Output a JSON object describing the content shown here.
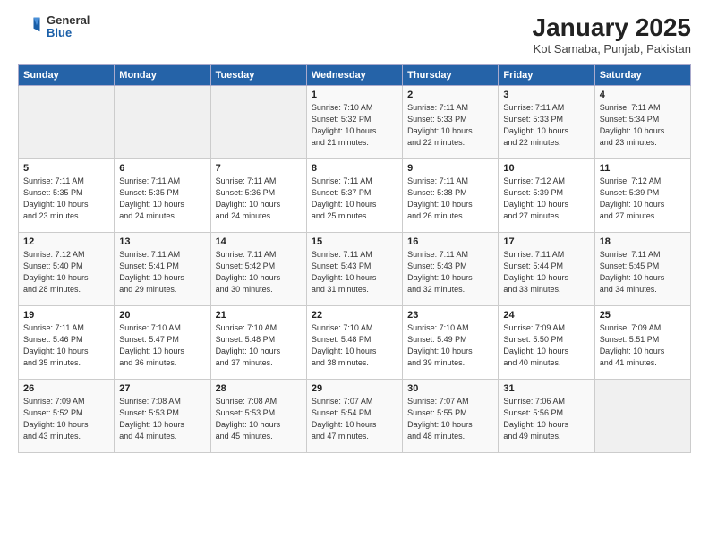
{
  "header": {
    "logo_general": "General",
    "logo_blue": "Blue",
    "title": "January 2025",
    "subtitle": "Kot Samaba, Punjab, Pakistan"
  },
  "days_of_week": [
    "Sunday",
    "Monday",
    "Tuesday",
    "Wednesday",
    "Thursday",
    "Friday",
    "Saturday"
  ],
  "weeks": [
    [
      {
        "num": "",
        "info": ""
      },
      {
        "num": "",
        "info": ""
      },
      {
        "num": "",
        "info": ""
      },
      {
        "num": "1",
        "info": "Sunrise: 7:10 AM\nSunset: 5:32 PM\nDaylight: 10 hours\nand 21 minutes."
      },
      {
        "num": "2",
        "info": "Sunrise: 7:11 AM\nSunset: 5:33 PM\nDaylight: 10 hours\nand 22 minutes."
      },
      {
        "num": "3",
        "info": "Sunrise: 7:11 AM\nSunset: 5:33 PM\nDaylight: 10 hours\nand 22 minutes."
      },
      {
        "num": "4",
        "info": "Sunrise: 7:11 AM\nSunset: 5:34 PM\nDaylight: 10 hours\nand 23 minutes."
      }
    ],
    [
      {
        "num": "5",
        "info": "Sunrise: 7:11 AM\nSunset: 5:35 PM\nDaylight: 10 hours\nand 23 minutes."
      },
      {
        "num": "6",
        "info": "Sunrise: 7:11 AM\nSunset: 5:35 PM\nDaylight: 10 hours\nand 24 minutes."
      },
      {
        "num": "7",
        "info": "Sunrise: 7:11 AM\nSunset: 5:36 PM\nDaylight: 10 hours\nand 24 minutes."
      },
      {
        "num": "8",
        "info": "Sunrise: 7:11 AM\nSunset: 5:37 PM\nDaylight: 10 hours\nand 25 minutes."
      },
      {
        "num": "9",
        "info": "Sunrise: 7:11 AM\nSunset: 5:38 PM\nDaylight: 10 hours\nand 26 minutes."
      },
      {
        "num": "10",
        "info": "Sunrise: 7:12 AM\nSunset: 5:39 PM\nDaylight: 10 hours\nand 27 minutes."
      },
      {
        "num": "11",
        "info": "Sunrise: 7:12 AM\nSunset: 5:39 PM\nDaylight: 10 hours\nand 27 minutes."
      }
    ],
    [
      {
        "num": "12",
        "info": "Sunrise: 7:12 AM\nSunset: 5:40 PM\nDaylight: 10 hours\nand 28 minutes."
      },
      {
        "num": "13",
        "info": "Sunrise: 7:11 AM\nSunset: 5:41 PM\nDaylight: 10 hours\nand 29 minutes."
      },
      {
        "num": "14",
        "info": "Sunrise: 7:11 AM\nSunset: 5:42 PM\nDaylight: 10 hours\nand 30 minutes."
      },
      {
        "num": "15",
        "info": "Sunrise: 7:11 AM\nSunset: 5:43 PM\nDaylight: 10 hours\nand 31 minutes."
      },
      {
        "num": "16",
        "info": "Sunrise: 7:11 AM\nSunset: 5:43 PM\nDaylight: 10 hours\nand 32 minutes."
      },
      {
        "num": "17",
        "info": "Sunrise: 7:11 AM\nSunset: 5:44 PM\nDaylight: 10 hours\nand 33 minutes."
      },
      {
        "num": "18",
        "info": "Sunrise: 7:11 AM\nSunset: 5:45 PM\nDaylight: 10 hours\nand 34 minutes."
      }
    ],
    [
      {
        "num": "19",
        "info": "Sunrise: 7:11 AM\nSunset: 5:46 PM\nDaylight: 10 hours\nand 35 minutes."
      },
      {
        "num": "20",
        "info": "Sunrise: 7:10 AM\nSunset: 5:47 PM\nDaylight: 10 hours\nand 36 minutes."
      },
      {
        "num": "21",
        "info": "Sunrise: 7:10 AM\nSunset: 5:48 PM\nDaylight: 10 hours\nand 37 minutes."
      },
      {
        "num": "22",
        "info": "Sunrise: 7:10 AM\nSunset: 5:48 PM\nDaylight: 10 hours\nand 38 minutes."
      },
      {
        "num": "23",
        "info": "Sunrise: 7:10 AM\nSunset: 5:49 PM\nDaylight: 10 hours\nand 39 minutes."
      },
      {
        "num": "24",
        "info": "Sunrise: 7:09 AM\nSunset: 5:50 PM\nDaylight: 10 hours\nand 40 minutes."
      },
      {
        "num": "25",
        "info": "Sunrise: 7:09 AM\nSunset: 5:51 PM\nDaylight: 10 hours\nand 41 minutes."
      }
    ],
    [
      {
        "num": "26",
        "info": "Sunrise: 7:09 AM\nSunset: 5:52 PM\nDaylight: 10 hours\nand 43 minutes."
      },
      {
        "num": "27",
        "info": "Sunrise: 7:08 AM\nSunset: 5:53 PM\nDaylight: 10 hours\nand 44 minutes."
      },
      {
        "num": "28",
        "info": "Sunrise: 7:08 AM\nSunset: 5:53 PM\nDaylight: 10 hours\nand 45 minutes."
      },
      {
        "num": "29",
        "info": "Sunrise: 7:07 AM\nSunset: 5:54 PM\nDaylight: 10 hours\nand 47 minutes."
      },
      {
        "num": "30",
        "info": "Sunrise: 7:07 AM\nSunset: 5:55 PM\nDaylight: 10 hours\nand 48 minutes."
      },
      {
        "num": "31",
        "info": "Sunrise: 7:06 AM\nSunset: 5:56 PM\nDaylight: 10 hours\nand 49 minutes."
      },
      {
        "num": "",
        "info": ""
      }
    ]
  ]
}
